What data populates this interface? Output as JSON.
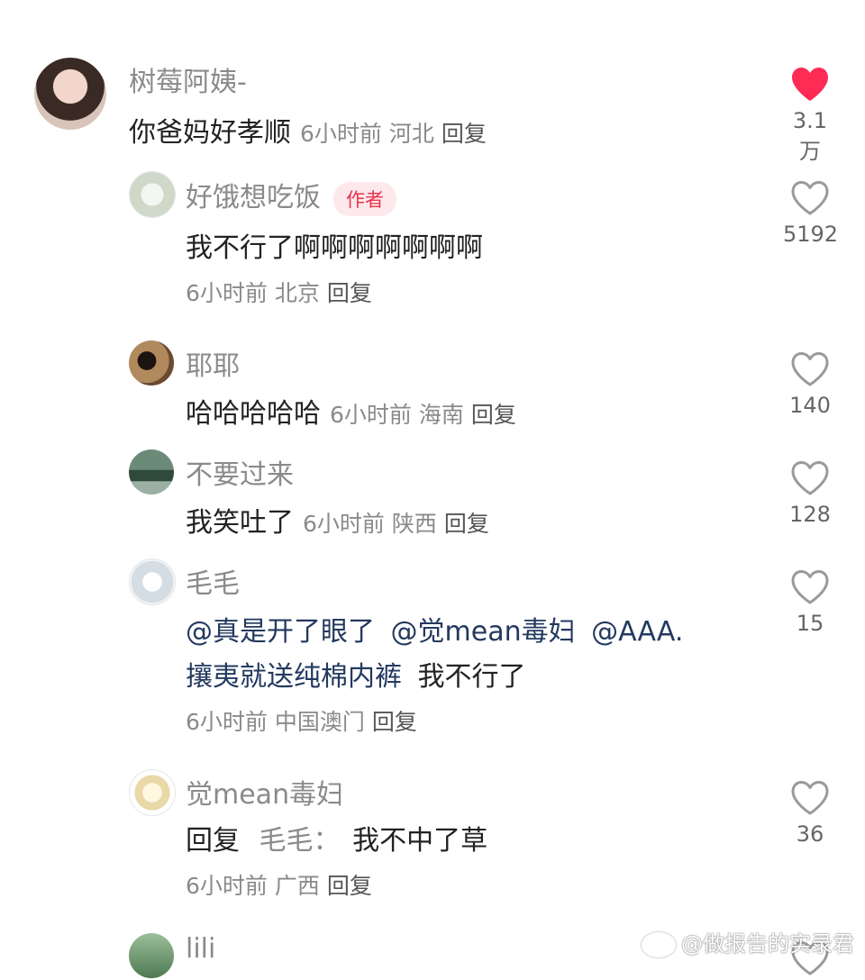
{
  "colors": {
    "like_active": "#fe2c55",
    "like_inactive": "#9a9a9a",
    "mention": "#23395f",
    "badge_text": "#e8344e",
    "badge_bg": "#fde9ec"
  },
  "comments": [
    {
      "user": "树莓阿姨-",
      "text": "你爸妈好孝顺",
      "time": "6小时前",
      "location": "河北",
      "reply_label": "回复",
      "likes": "3.1万",
      "liked": true
    },
    {
      "user": "好饿想吃饭",
      "badge": "作者",
      "text": "我不行了啊啊啊啊啊啊啊",
      "time": "6小时前",
      "location": "北京",
      "reply_label": "回复",
      "likes": "5192"
    },
    {
      "user": "耶耶",
      "text": "哈哈哈哈哈",
      "time": "6小时前",
      "location": "海南",
      "reply_label": "回复",
      "likes": "140"
    },
    {
      "user": "不要过来",
      "text": "我笑吐了",
      "time": "6小时前",
      "location": "陕西",
      "reply_label": "回复",
      "likes": "128"
    },
    {
      "user": "毛毛",
      "mention1": "@真是开了眼了",
      "mention2": "@觉mean毒妇",
      "mention3": "@AAA.",
      "mention4": "攘夷就送纯棉内裤",
      "text_tail": "我不行了",
      "time": "6小时前",
      "location": "中国澳门",
      "reply_label": "回复",
      "likes": "15"
    },
    {
      "user": "觉mean毒妇",
      "reply_prefix": "回复",
      "reply_to": "毛毛：",
      "text": "我不中了草",
      "time": "6小时前",
      "location": "广西",
      "reply_label": "回复",
      "likes": "36"
    },
    {
      "user": "lili"
    }
  ],
  "watermark": "@做报告的实录君"
}
